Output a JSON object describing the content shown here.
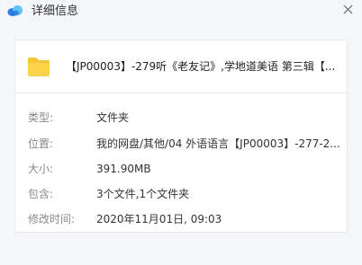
{
  "window": {
    "title": "详细信息"
  },
  "file": {
    "name": "【JP00003】-279听《老友记》,学地道美语  第三辑【..."
  },
  "properties": {
    "type_label": "类型:",
    "type_value": "文件夹",
    "location_label": "位置:",
    "location_value": "我的网盘/其他/04 外语语言【JP00003】-277-2...",
    "size_label": "大小:",
    "size_value": "391.90MB",
    "contains_label": "包含:",
    "contains_value": "3个文件,1个文件夹",
    "modified_label": "修改时间:",
    "modified_value": "2020年11月01日, 09:03"
  },
  "icons": {
    "app": "cloud-icon",
    "close": "close-icon",
    "file": "folder-icon"
  },
  "colors": {
    "folder": "#f7c733",
    "app_icon_blue": "#2b7de9",
    "app_icon_light": "#5dc3f2"
  }
}
